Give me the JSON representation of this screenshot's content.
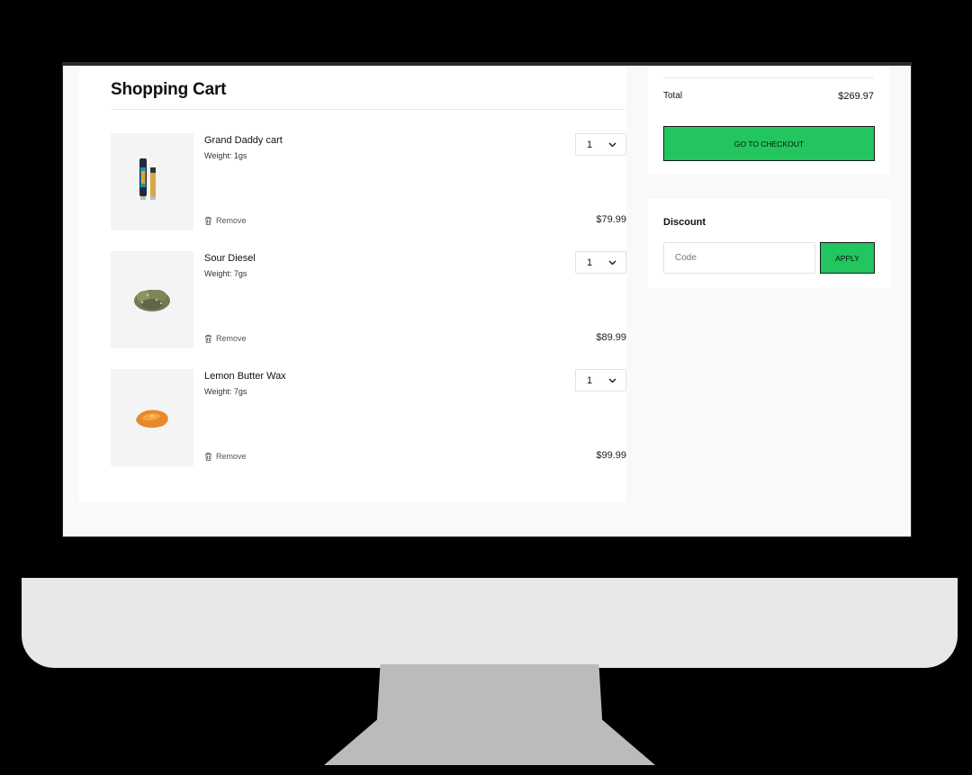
{
  "cart": {
    "title": "Shopping Cart",
    "remove_label": "Remove",
    "items": [
      {
        "name": "Grand Daddy cart",
        "weight": "Weight: 1gs",
        "qty": "1",
        "price": "$79.99"
      },
      {
        "name": "Sour Diesel",
        "weight": "Weight: 7gs",
        "qty": "1",
        "price": "$89.99"
      },
      {
        "name": "Lemon Butter Wax",
        "weight": "Weight: 7gs",
        "qty": "1",
        "price": "$99.99"
      }
    ]
  },
  "summary": {
    "total_label": "Total",
    "total_value": "$269.97",
    "checkout_label": "GO TO CHECKOUT"
  },
  "discount": {
    "title": "Discount",
    "code_placeholder": "Code",
    "code_value": "",
    "apply_label": "APPLY"
  },
  "colors": {
    "accent": "#22c55e",
    "background": "#f8f9fb"
  }
}
